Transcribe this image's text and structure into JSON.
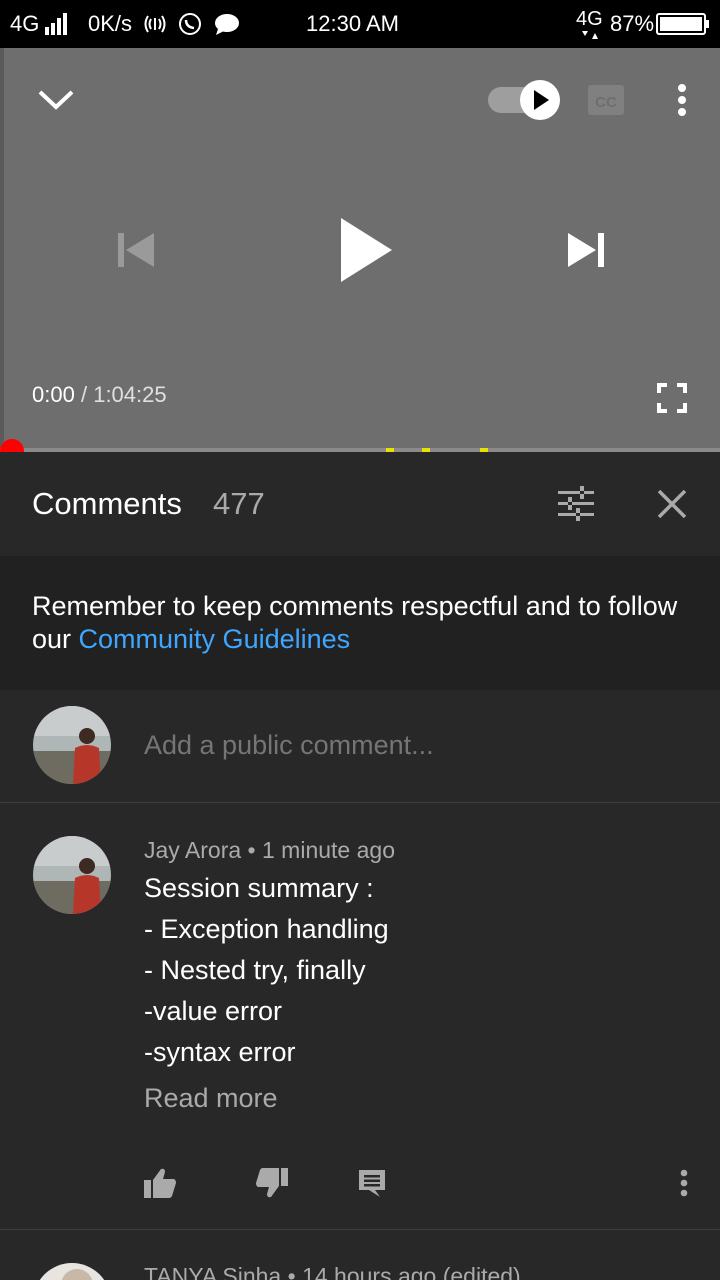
{
  "status_bar": {
    "network_left": "4G",
    "speed": "0K/s",
    "time": "12:30 AM",
    "network_right": "4G",
    "battery": "87%"
  },
  "player": {
    "current_time": "0:00",
    "separator": "/",
    "duration": "1:04:25",
    "cc_label": "CC",
    "progress_fraction": 0
  },
  "comments": {
    "title": "Comments",
    "count": "477",
    "notice_text": "Remember to keep comments respectful and to follow our ",
    "notice_link": "Community Guidelines",
    "add_placeholder": "Add a public comment...",
    "items": [
      {
        "author": "Jay Arora",
        "time": "1 minute ago",
        "lines": [
          "Session summary :",
          "- Exception handling",
          "- Nested try, finally",
          "-value error",
          "-syntax error"
        ],
        "read_more": "Read more"
      },
      {
        "author": "TANYA Sinha",
        "time": "14 hours ago (edited)"
      }
    ]
  },
  "colors": {
    "accent_red": "#ff0000",
    "link_blue": "#3ea6ff",
    "ad_marker": "#e8e200"
  }
}
